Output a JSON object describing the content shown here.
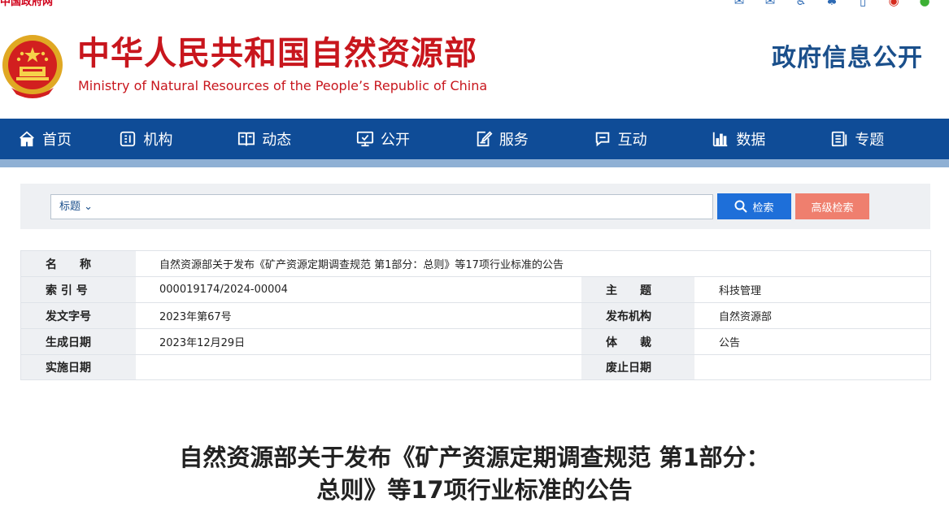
{
  "topbar": {
    "gov_link": "中国政府网",
    "icons": [
      "mail-icon",
      "mail-alt-icon",
      "accessibility-icon",
      "tree-icon",
      "mobile-icon",
      "weibo-icon",
      "wechat-icon"
    ]
  },
  "header": {
    "title_cn": "中华人民共和国自然资源部",
    "title_en": "Ministry of Natural Resources of the People’s Republic of China",
    "section_title": "政府信息公开"
  },
  "nav": {
    "items": [
      {
        "label": "首页",
        "icon": "home-icon"
      },
      {
        "label": "机构",
        "icon": "org-icon"
      },
      {
        "label": "动态",
        "icon": "book-icon"
      },
      {
        "label": "公开",
        "icon": "monitor-icon"
      },
      {
        "label": "服务",
        "icon": "edit-icon"
      },
      {
        "label": "互动",
        "icon": "chat-icon"
      },
      {
        "label": "数据",
        "icon": "bar-chart-icon"
      },
      {
        "label": "专题",
        "icon": "topic-icon"
      }
    ]
  },
  "search": {
    "field_select": "标题",
    "input_value": "",
    "search_label": "检索",
    "advanced_label": "高级检索"
  },
  "info": {
    "name_label": "名　　称",
    "name_value": "自然资源部关于发布《矿产资源定期调查规范 第1部分：总则》等17项行业标准的公告",
    "index_label": "索 引 号",
    "index_value": "000019174/2024-00004",
    "topic_label": "主　　题",
    "topic_value": "科技管理",
    "docno_label": "发文字号",
    "docno_value": "2023年第67号",
    "publisher_label": "发布机构",
    "publisher_value": "自然资源部",
    "date_label": "生成日期",
    "date_value": "2023年12月29日",
    "genre_label": "体　　裁",
    "genre_value": "公告",
    "effective_label": "实施日期",
    "effective_value": "",
    "abolish_label": "废止日期",
    "abolish_value": ""
  },
  "article": {
    "title_line1": "自然资源部关于发布《矿产资源定期调查规范 第1部分：",
    "title_line2": "总则》等17项行业标准的公告"
  }
}
